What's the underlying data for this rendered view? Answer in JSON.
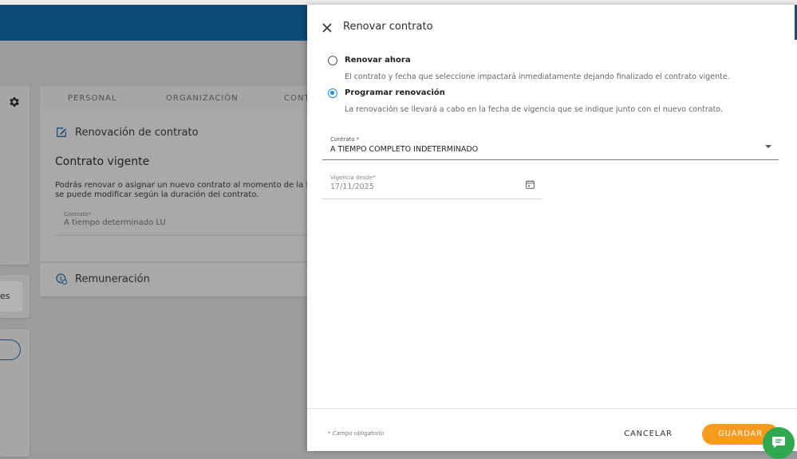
{
  "background": {
    "tabs": [
      "PERSONAL",
      "ORGANIZACIÓN",
      "CONT"
    ],
    "left_partial_text": "es",
    "renewal_section": {
      "title": "Renovación de contrato",
      "heading": "Contrato vigente",
      "description_line1": "Podrás renovar o asignar un nuevo contrato al momento de la fecha de ven",
      "description_line2": "se puede modificar según la duración del contrato.",
      "field_label": "Contrato*",
      "field_value": "A tiempo determinado LU"
    },
    "remuneration_section": {
      "title": "Remuneración"
    }
  },
  "drawer": {
    "title": "Renovar contrato",
    "options": [
      {
        "label": "Renovar ahora",
        "description": "El contrato y fecha que seleccione impactará inmediatamente dejando finalizado el contrato vigente.",
        "selected": false
      },
      {
        "label": "Programar renovación",
        "description": "La renovación se llevará a cabo en la fecha de vigencia que se indique junto con el nuevo contrato.",
        "selected": true
      }
    ],
    "contract_field": {
      "label": "Contrato *",
      "value": "A TIEMPO COMPLETO INDETERMINADO"
    },
    "date_field": {
      "label": "Vigencia desde*",
      "value": "17/11/2025"
    },
    "footer": {
      "required_note": "* Campo obligatorio",
      "cancel_label": "CANCELAR",
      "save_label": "GUARDAR"
    }
  },
  "colors": {
    "app_bar": "#0e4a76",
    "radio_selected": "#1e88e5",
    "save_button": "#f79b1e",
    "chat_fab": "#2fa84f"
  },
  "icons": [
    "gear-icon",
    "edit-document-icon",
    "money-icon",
    "close-icon",
    "chevron-down-icon",
    "calendar-icon",
    "chat-icon"
  ]
}
